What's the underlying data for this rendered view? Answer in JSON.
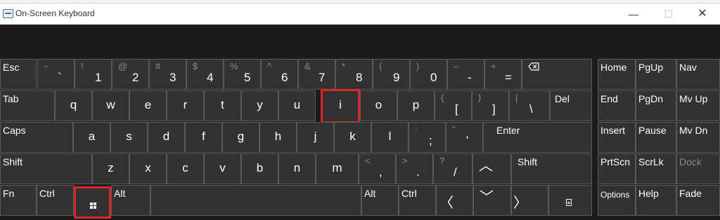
{
  "window": {
    "title": "On-Screen Keyboard",
    "minimize": "—",
    "maximize": "☐",
    "close": "✕"
  },
  "keys": {
    "esc": "Esc",
    "tilde": {
      "shift": "~",
      "base": "`"
    },
    "d1": {
      "shift": "!",
      "base": "1"
    },
    "d2": {
      "shift": "@",
      "base": "2"
    },
    "d3": {
      "shift": "#",
      "base": "3"
    },
    "d4": {
      "shift": "$",
      "base": "4"
    },
    "d5": {
      "shift": "%",
      "base": "5"
    },
    "d6": {
      "shift": "^",
      "base": "6"
    },
    "d7": {
      "shift": "&",
      "base": "7"
    },
    "d8": {
      "shift": "*",
      "base": "8"
    },
    "d9": {
      "shift": "(",
      "base": "9"
    },
    "d0": {
      "shift": ")",
      "base": "0"
    },
    "minus": {
      "shift": "–",
      "base": "-"
    },
    "equals": {
      "shift": "+",
      "base": "="
    },
    "backspace_icon": "backspace-icon",
    "tab": "Tab",
    "q": "q",
    "w": "w",
    "e": "e",
    "r": "r",
    "t": "t",
    "y": "y",
    "u": "u",
    "i": "i",
    "o": "o",
    "p": "p",
    "lbracket": {
      "shift": "{",
      "base": "["
    },
    "rbracket": {
      "shift": "}",
      "base": "]"
    },
    "backslash": {
      "shift": "|",
      "base": "\\"
    },
    "del": "Del",
    "caps": "Caps",
    "a": "a",
    "s": "s",
    "d": "d",
    "f": "f",
    "g": "g",
    "h": "h",
    "j": "j",
    "k": "k",
    "l": "l",
    "semicolon": {
      "shift": ":",
      "base": ";"
    },
    "quote": {
      "shift": "\"",
      "base": "'"
    },
    "enter": "Enter",
    "lshift": "Shift",
    "z": "z",
    "x": "x",
    "c": "c",
    "v": "v",
    "b": "b",
    "n": "n",
    "m": "m",
    "comma": {
      "shift": "<",
      "base": ","
    },
    "period": {
      "shift": ">",
      "base": "."
    },
    "slash": {
      "shift": "?",
      "base": "/"
    },
    "up": "︿",
    "rshift": "Shift",
    "fn": "Fn",
    "lctrl": "Ctrl",
    "win_icon": "windows-logo-icon",
    "lalt": "Alt",
    "space": "",
    "ralt": "Alt",
    "rctrl": "Ctrl",
    "left": "〈",
    "down": "﹀",
    "right": "〉",
    "menu_icon": "context-menu-icon",
    "home": "Home",
    "pgup": "PgUp",
    "nav": "Nav",
    "end": "End",
    "pgdn": "PgDn",
    "mvup": "Mv Up",
    "insert": "Insert",
    "pause": "Pause",
    "mvdn": "Mv Dn",
    "prtscn": "PrtScn",
    "scrlk": "ScrLk",
    "dock": "Dock",
    "options": "Options",
    "help": "Help",
    "fade": "Fade"
  },
  "highlighted_keys": [
    "i",
    "windows"
  ],
  "colors": {
    "key_bg": "#323232",
    "key_border": "#5a5a5a",
    "highlight": "#d7262d",
    "dim_text": "#8a8a8a"
  }
}
